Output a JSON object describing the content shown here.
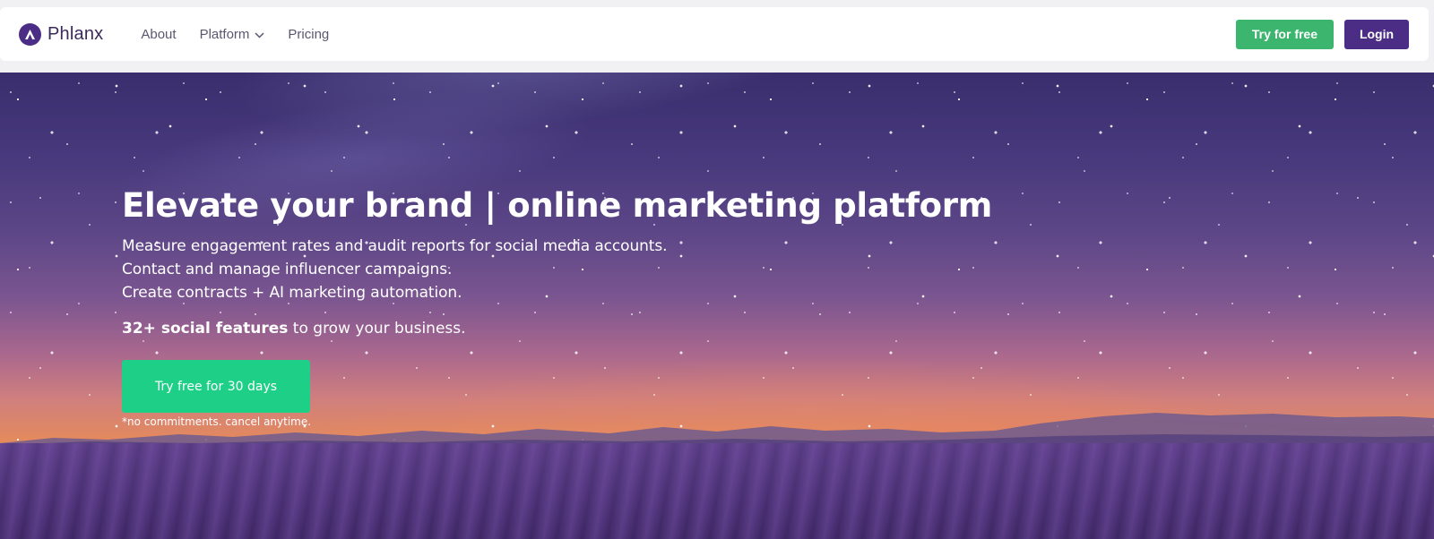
{
  "nav": {
    "brand_name": "Phlanx",
    "links": [
      {
        "label": "About"
      },
      {
        "label": "Platform",
        "has_dropdown": true
      },
      {
        "label": "Pricing"
      }
    ],
    "try_button": "Try for free",
    "login_button": "Login"
  },
  "hero": {
    "headline": "Elevate your brand | online marketing platform",
    "lines": [
      "Measure engagement rates and audit reports for social media accounts.",
      "Contact and manage influencer campaigns.",
      "Create contracts + AI marketing automation."
    ],
    "features_bold": "32+ social features",
    "features_rest": " to grow your business.",
    "cta_label": "Try free for 30 days",
    "cta_note": "*no commitments. cancel anytime."
  },
  "colors": {
    "brand_purple": "#4b2d86",
    "try_green": "#3cb66e",
    "cta_green": "#1ed087"
  },
  "icons": {
    "logo": "phlanx-logo-icon",
    "dropdown": "chevron-down-icon"
  }
}
